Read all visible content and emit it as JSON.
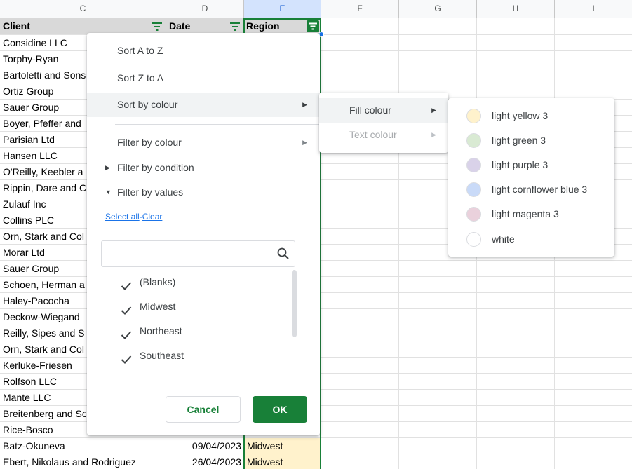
{
  "columns": [
    {
      "letter": "C"
    },
    {
      "letter": "D"
    },
    {
      "letter": "E"
    },
    {
      "letter": "F"
    },
    {
      "letter": "G"
    },
    {
      "letter": "H"
    },
    {
      "letter": "I"
    }
  ],
  "headers": {
    "client": "Client",
    "date": "Date",
    "region": "Region"
  },
  "rows": [
    {
      "client": "Considine LLC"
    },
    {
      "client": "Torphy-Ryan"
    },
    {
      "client": "Bartoletti and Sons"
    },
    {
      "client": "Ortiz Group"
    },
    {
      "client": "Sauer Group"
    },
    {
      "client": "Boyer, Pfeffer and"
    },
    {
      "client": "Parisian Ltd"
    },
    {
      "client": "Hansen LLC"
    },
    {
      "client": "O'Reilly, Keebler a"
    },
    {
      "client": "Rippin, Dare and C"
    },
    {
      "client": "Zulauf Inc"
    },
    {
      "client": "Collins PLC"
    },
    {
      "client": "Orn, Stark and Col"
    },
    {
      "client": "Morar Ltd"
    },
    {
      "client": "Sauer Group"
    },
    {
      "client": "Schoen, Herman a"
    },
    {
      "client": "Haley-Pacocha"
    },
    {
      "client": "Deckow-Wiegand"
    },
    {
      "client": "Reilly, Sipes and S"
    },
    {
      "client": "Orn, Stark and Col"
    },
    {
      "client": "Kerluke-Friesen"
    },
    {
      "client": "Rolfson LLC"
    },
    {
      "client": "Mante LLC"
    },
    {
      "client": "Breitenberg and So"
    },
    {
      "client": "Rice-Bosco"
    },
    {
      "client": "Batz-Okuneva",
      "date": "09/04/2023",
      "region": "Midwest"
    },
    {
      "client": "Ebert, Nikolaus and Rodriguez",
      "date": "26/04/2023",
      "region": "Midwest"
    }
  ],
  "filter_menu": {
    "sort_az": "Sort A to Z",
    "sort_za": "Sort Z to A",
    "sort_by_colour": "Sort by colour",
    "filter_by_colour": "Filter by colour",
    "filter_by_condition": "Filter by condition",
    "filter_by_values": "Filter by values",
    "select_all": "Select all",
    "link_separator": "-",
    "clear": "Clear",
    "search_placeholder": "",
    "values": [
      {
        "label": "(Blanks)",
        "checked": true
      },
      {
        "label": "Midwest",
        "checked": true
      },
      {
        "label": "Northeast",
        "checked": true
      },
      {
        "label": "Southeast",
        "checked": true
      }
    ],
    "cancel": "Cancel",
    "ok": "OK"
  },
  "sort_colour_submenu": {
    "fill_colour": "Fill colour",
    "text_colour": "Text colour"
  },
  "fill_colour_options": [
    {
      "label": "light yellow 3",
      "color": "#fff2cc"
    },
    {
      "label": "light green 3",
      "color": "#d9ead3"
    },
    {
      "label": "light purple 3",
      "color": "#d9d2e9"
    },
    {
      "label": "light cornflower blue 3",
      "color": "#c9daf8"
    },
    {
      "label": "light magenta 3",
      "color": "#ead1dc"
    },
    {
      "label": "white",
      "color": "#ffffff"
    }
  ],
  "colors": {
    "accent_green": "#188038",
    "header_fill": "#d9d9d9",
    "region_fill": "#fff2cc",
    "link_blue": "#1a73e8"
  }
}
